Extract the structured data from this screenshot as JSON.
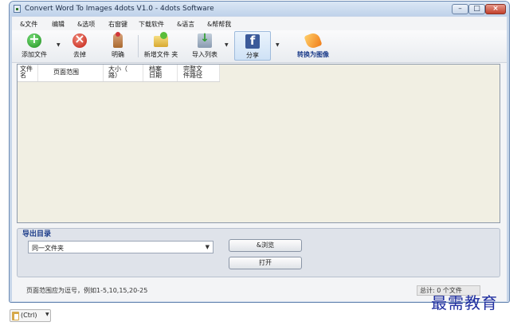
{
  "window": {
    "title": "Convert Word To Images 4dots V1.0 - 4dots Software",
    "controls": {
      "minimize": "–",
      "maximize": "□",
      "close": "×"
    }
  },
  "menu": [
    "&文件",
    "编辑",
    "&选项",
    "右窗键",
    "下载软件",
    "&语言",
    "&帮帮我"
  ],
  "toolbar": {
    "add_file": "添加文件",
    "remove": "去掉",
    "clear": "明确",
    "add_folder": "新增文件 夹",
    "import_list": "导入列表",
    "share": "分享",
    "convert": "转换为图像",
    "icons": {
      "add_file": "add-icon",
      "remove": "remove-icon",
      "clear": "clear-icon",
      "add_folder": "folder-icon",
      "import_list": "import-icon",
      "share": "facebook-icon",
      "convert": "convert-icon"
    }
  },
  "table": {
    "columns": [
      "文件名",
      "页面范围",
      "大小（ 路）",
      "档案 日期",
      "完整文 件路径"
    ]
  },
  "output": {
    "title": "导出目录",
    "folder_value": "同一文件夹",
    "browse": "&浏览",
    "open": "打开"
  },
  "status": {
    "hint": "页面范围应为逗号，例如1-5,10,15,20-25",
    "right": "总计: 0 个文件"
  },
  "watermark": "最需教育",
  "paste": {
    "label": "(Ctrl)"
  },
  "colors": {
    "accent": "#1d3d8a",
    "watermark": "#1f2ea0",
    "facebook": "#3b5a9a"
  }
}
